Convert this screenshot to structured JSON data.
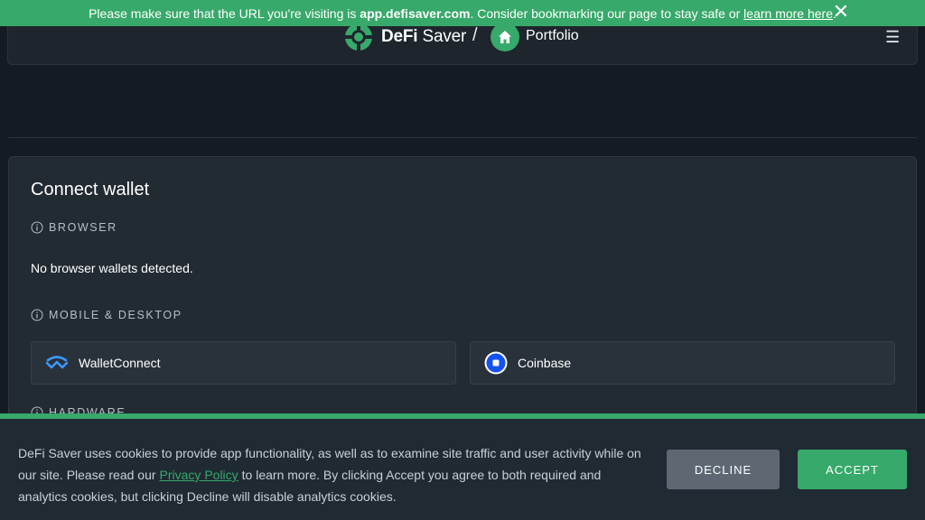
{
  "banner": {
    "prefix": "Please make sure that the URL you're visiting is",
    "domain": "app.defisaver.com",
    "middle": ". Consider bookmarking our page to stay safe or",
    "link": "learn more here",
    "suffix": ".",
    "close_glyph": "✕"
  },
  "header": {
    "logo_bold": "DeFi",
    "logo_regular": "Saver",
    "separator": "/",
    "page": "Portfolio",
    "menu_glyph": "☰"
  },
  "connect": {
    "title": "Connect wallet",
    "sections": {
      "browser": "BROWSER",
      "browser_empty": "No browser wallets detected.",
      "mobile": "MOBILE & DESKTOP",
      "hardware": "HARDWARE"
    },
    "wallets": [
      {
        "name": "WalletConnect",
        "icon": "walletconnect-icon"
      },
      {
        "name": "Coinbase",
        "icon": "coinbase-icon"
      }
    ]
  },
  "cookie": {
    "text_before": "DeFi Saver uses cookies to provide app functionality, as well as to examine site traffic and user activity while on our site. Please read our",
    "link": "Privacy Policy",
    "text_after": "to learn more. By clicking Accept you agree to both required and analytics cookies, but clicking Decline will disable analytics cookies.",
    "decline": "DECLINE",
    "accept": "ACCEPT"
  },
  "colors": {
    "brand_green": "#37a96a",
    "background": "#151b22",
    "panel": "#222a32",
    "decline_gray": "#5d6873"
  }
}
